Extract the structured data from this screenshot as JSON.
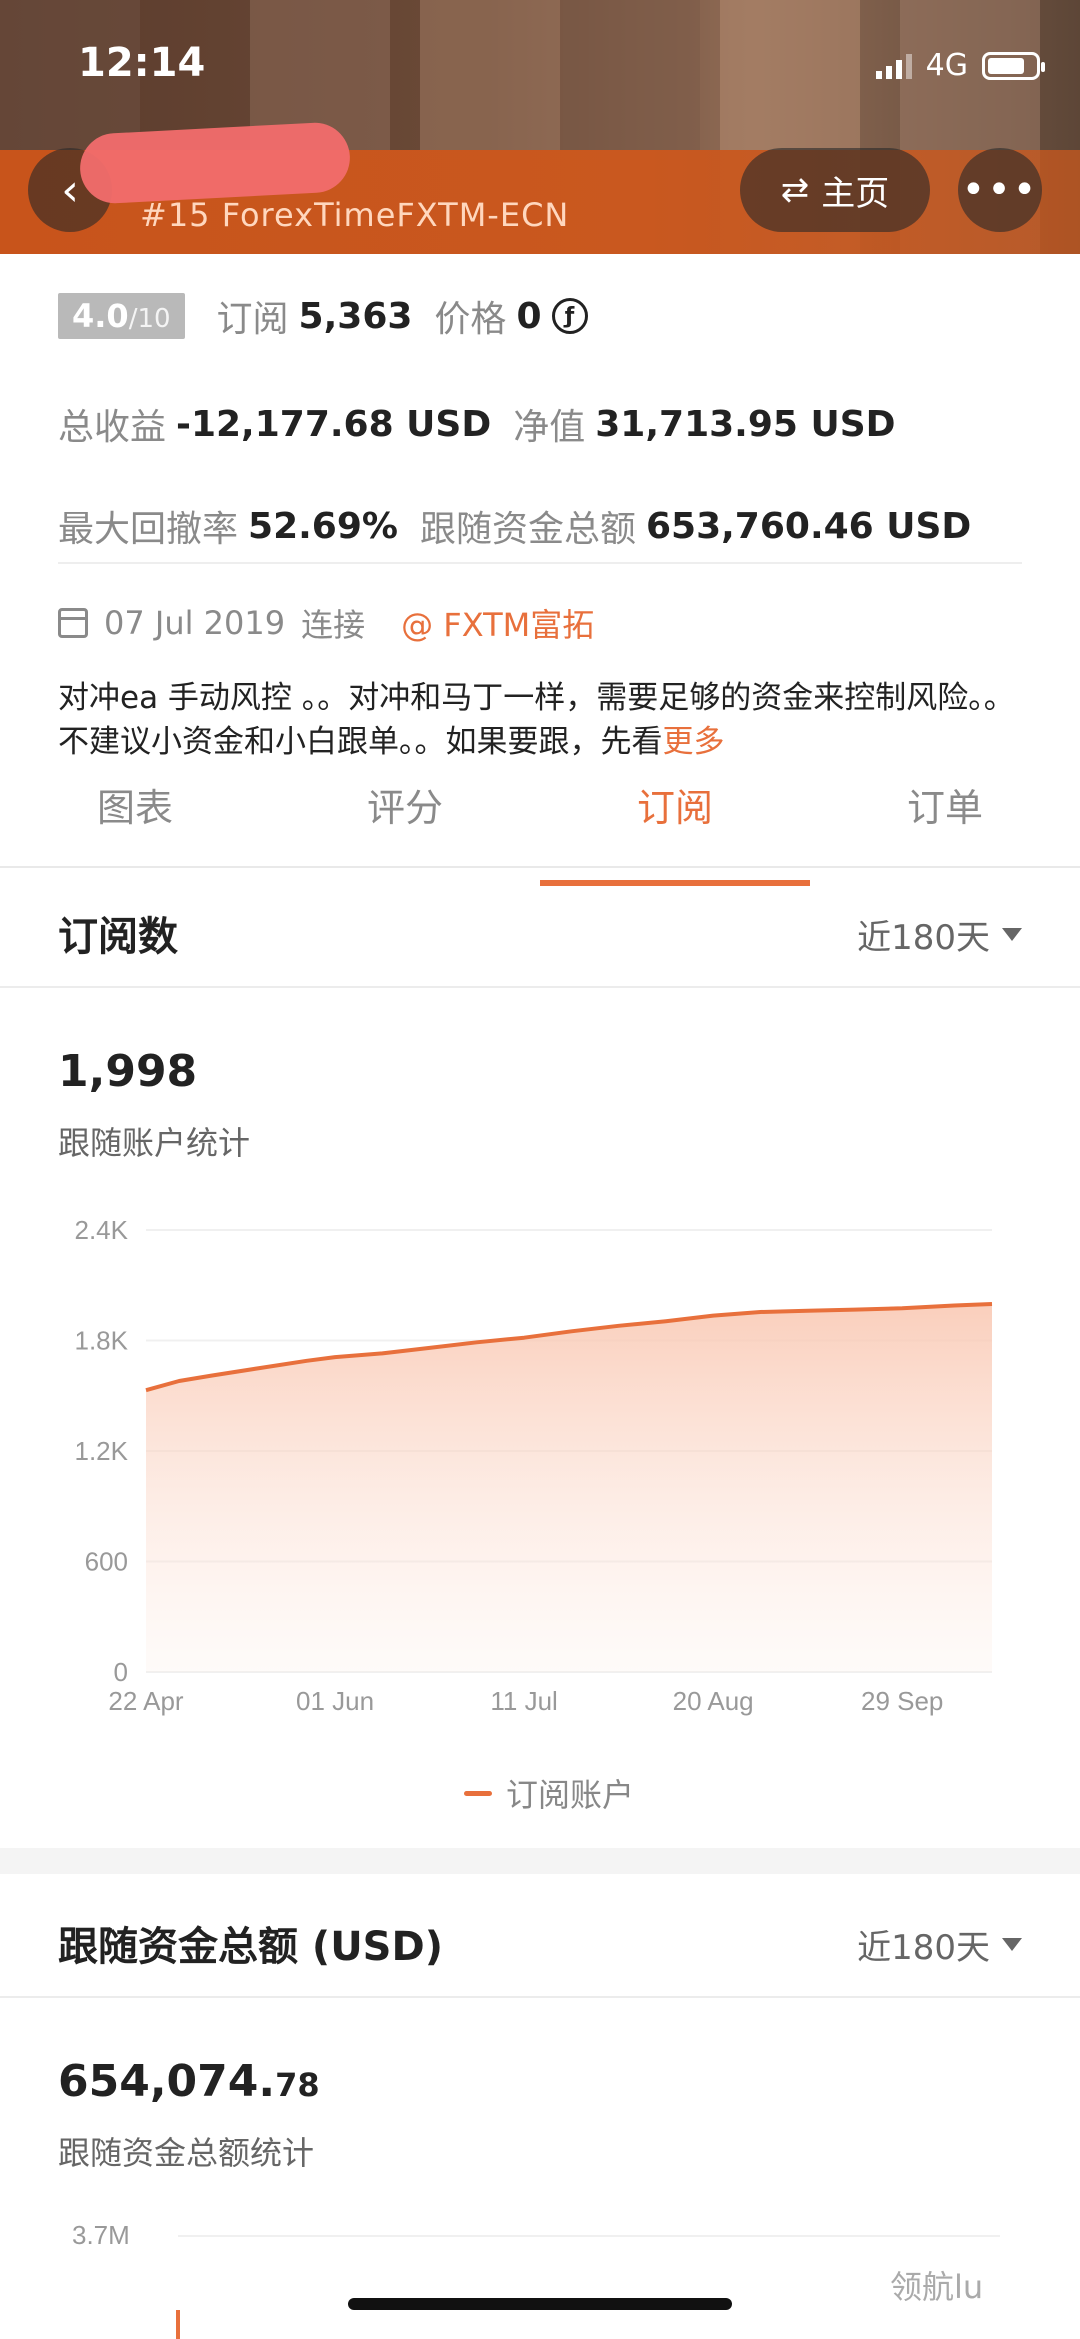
{
  "status_bar": {
    "time": "12:14",
    "network": "4G"
  },
  "header": {
    "account_name": "#15 ForexTimeFXTM-ECN",
    "home_label": "主页",
    "back_icon": "chevron-left-icon",
    "more_icon": "more-icon"
  },
  "stats": {
    "rating": "4.0",
    "rating_scale": "/10",
    "subscribe_label": "订阅",
    "subscribe_value": "5,363",
    "price_label": "价格",
    "price_value": "0",
    "total_profit_label": "总收益",
    "total_profit_value": "-12,177.68 USD",
    "equity_label": "净值",
    "equity_value": "31,713.95 USD",
    "drawdown_label": "最大回撤率",
    "drawdown_value": "52.69%",
    "follow_fund_label": "跟随资金总额",
    "follow_fund_value": "653,760.46 USD"
  },
  "connection": {
    "date": "07 Jul 2019",
    "status": "连接",
    "broker": "@ FXTM富拓"
  },
  "description": {
    "text": "对冲ea 手动风控 。。对冲和马丁一样，需要足够的资金来控制风险。。不建议小资金和小白跟单。。如果要跟，先看",
    "more": "更多"
  },
  "tabs": [
    "图表",
    "评分",
    "订阅",
    "订单"
  ],
  "active_tab": 2,
  "subs_section": {
    "title": "订阅数",
    "period": "近180天",
    "total": "1,998",
    "sub_label": "跟随账户统计",
    "legend": "订阅账户"
  },
  "fund_section": {
    "title": "跟随资金总额 (USD)",
    "period": "近180天",
    "total_main": "654,074.",
    "total_decimal": "78",
    "sub_label": "跟随资金总额统计",
    "first_tick": "3.7M"
  },
  "watermark": "领航lu",
  "colors": {
    "accent": "#e8703c",
    "header_orange": "#c8541b"
  },
  "chart_data": {
    "type": "area",
    "x_ticks": [
      "22 Apr",
      "01 Jun",
      "11 Jul",
      "20 Aug",
      "29 Sep"
    ],
    "y_ticks": [
      "0",
      "600",
      "1.2K",
      "1.8K",
      "2.4K"
    ],
    "ylim": [
      0,
      2400
    ],
    "series": [
      {
        "name": "订阅账户",
        "points": [
          [
            "22 Apr",
            1530
          ],
          [
            "29 Apr",
            1580
          ],
          [
            "06 May",
            1610
          ],
          [
            "16 May",
            1650
          ],
          [
            "26 May",
            1690
          ],
          [
            "01 Jun",
            1710
          ],
          [
            "11 Jun",
            1730
          ],
          [
            "21 Jun",
            1760
          ],
          [
            "01 Jul",
            1790
          ],
          [
            "11 Jul",
            1815
          ],
          [
            "21 Jul",
            1850
          ],
          [
            "31 Jul",
            1880
          ],
          [
            "10 Aug",
            1905
          ],
          [
            "20 Aug",
            1935
          ],
          [
            "30 Aug",
            1955
          ],
          [
            "09 Sep",
            1962
          ],
          [
            "19 Sep",
            1968
          ],
          [
            "29 Sep",
            1975
          ],
          [
            "10 Oct",
            1990
          ],
          [
            "18 Oct",
            1998
          ]
        ]
      }
    ]
  }
}
